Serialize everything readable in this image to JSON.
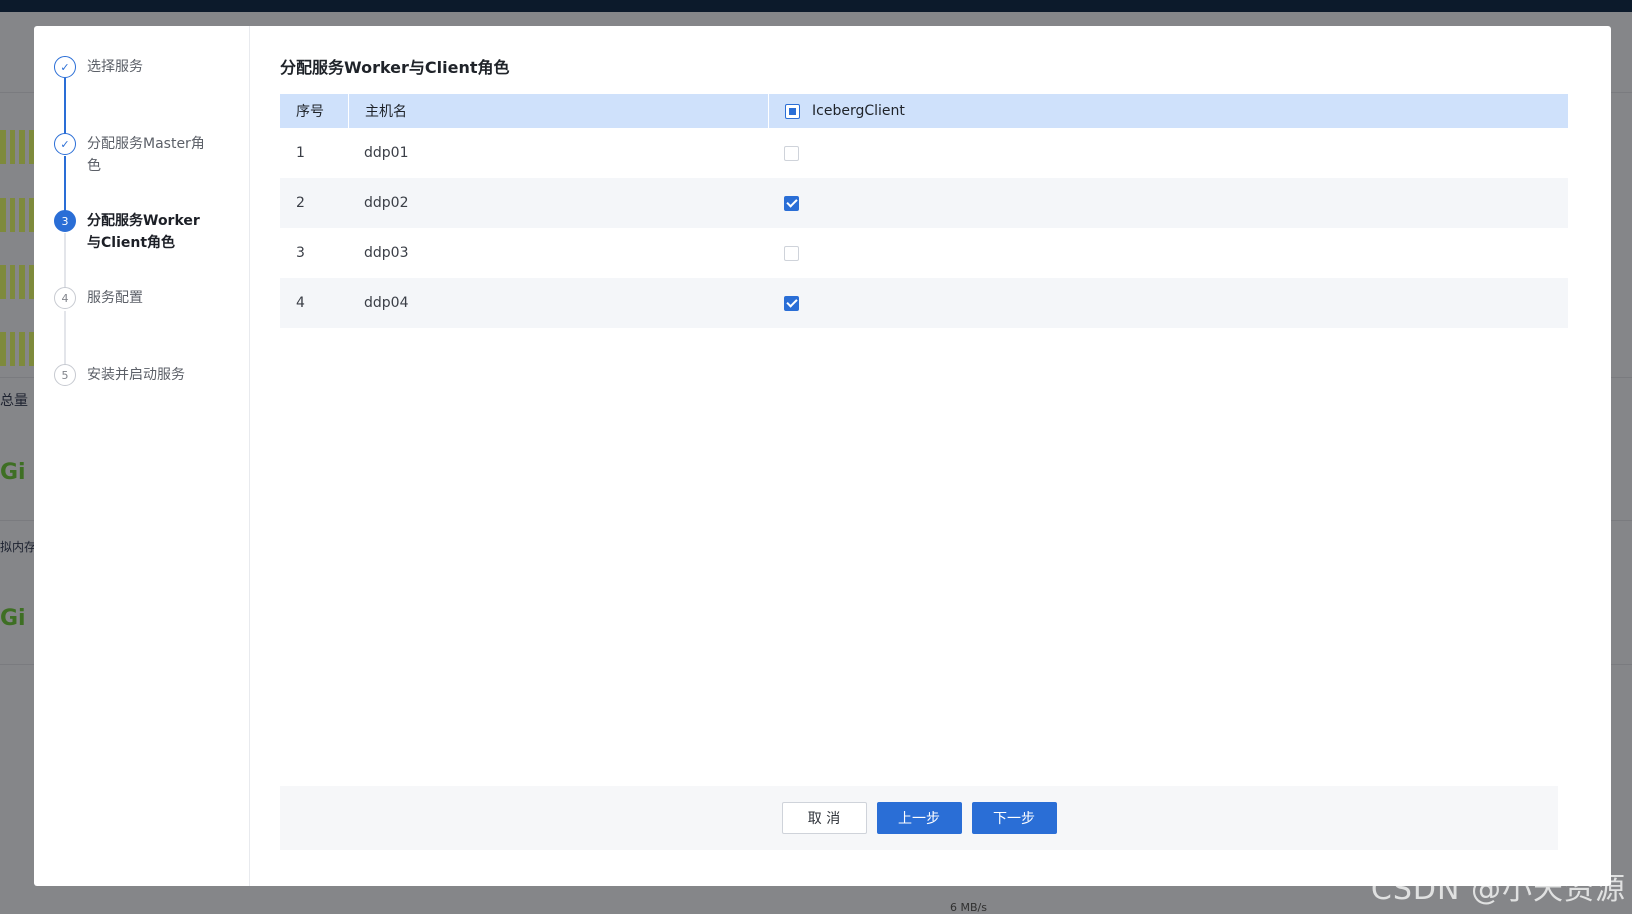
{
  "background": {
    "labels": [
      "总量",
      "拟内存"
    ],
    "big_values": [
      "Gi",
      "Gi"
    ],
    "axis_label": "6 MB/s"
  },
  "steps": [
    {
      "num": "✓",
      "label": "选择服务",
      "state": "done"
    },
    {
      "num": "✓",
      "label": "分配服务Master角色",
      "state": "done"
    },
    {
      "num": "3",
      "label": "分配服务Worker与Client角色",
      "state": "active"
    },
    {
      "num": "4",
      "label": "服务配置",
      "state": "todo"
    },
    {
      "num": "5",
      "label": "安装并启动服务",
      "state": "todo"
    }
  ],
  "section_title": "分配服务Worker与Client角色",
  "table": {
    "headers": {
      "index": "序号",
      "host": "主机名",
      "role": "IcebergClient"
    },
    "header_check_state": "partial",
    "rows": [
      {
        "index": "1",
        "host": "ddp01",
        "checked": false
      },
      {
        "index": "2",
        "host": "ddp02",
        "checked": true
      },
      {
        "index": "3",
        "host": "ddp03",
        "checked": false
      },
      {
        "index": "4",
        "host": "ddp04",
        "checked": true
      }
    ]
  },
  "buttons": {
    "cancel": "取 消",
    "prev": "上一步",
    "next": "下一步"
  },
  "watermark": "CSDN @小天资源",
  "colors": {
    "accent": "#2a6ed6",
    "header_bg": "#cfe1fb"
  }
}
